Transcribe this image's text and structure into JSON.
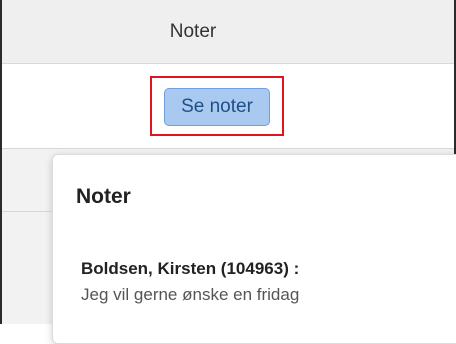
{
  "table": {
    "column_header": "Noter",
    "row_button_label": "Se noter"
  },
  "popover": {
    "title": "Noter",
    "notes": [
      {
        "author": "Boldsen, Kirsten (104963) :",
        "text": "Jeg vil gerne ønske en fridag"
      }
    ]
  },
  "colors": {
    "highlight_border": "#e0141e",
    "button_background": "#a9c9f0",
    "button_text": "#1f4f86"
  }
}
